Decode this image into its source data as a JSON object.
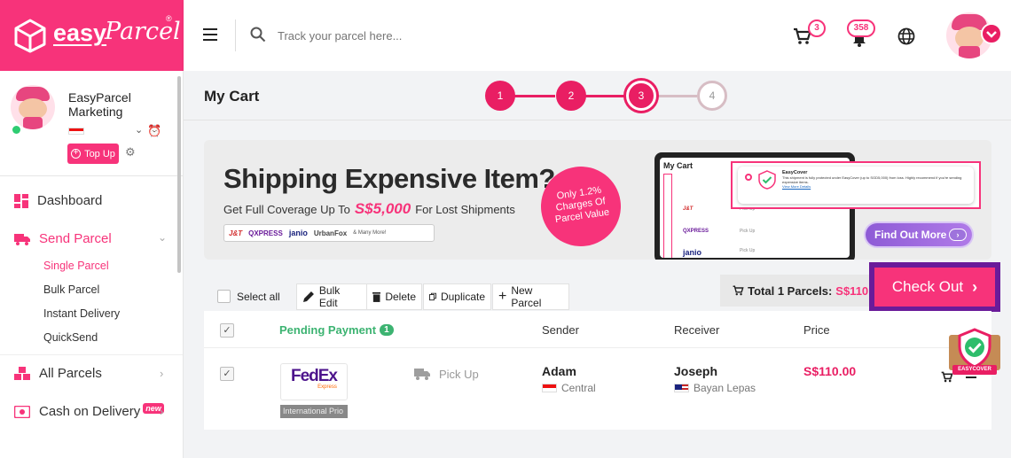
{
  "brand": {
    "name": "easy",
    "name_script": "Parcel",
    "registered": "®"
  },
  "search": {
    "placeholder": "Track your parcel here..."
  },
  "header": {
    "cart_count": "3",
    "notification_count": "358"
  },
  "profile": {
    "name": "EasyParcel Marketing",
    "topup_label": "Top Up"
  },
  "nav": {
    "dashboard": "Dashboard",
    "send_parcel": "Send Parcel",
    "sub_items": [
      "Single Parcel",
      "Bulk Parcel",
      "Instant Delivery",
      "QuickSend"
    ],
    "all_parcels": "All Parcels",
    "cod": "Cash on Delivery",
    "cod_badge": "new"
  },
  "page": {
    "title": "My Cart",
    "steps": [
      "1",
      "2",
      "3",
      "4"
    ],
    "current_step": 3
  },
  "banner": {
    "headline": "Shipping Expensive Item?",
    "subline_prefix": "Get Full Coverage Up To",
    "subline_amount": "S$5,000",
    "subline_suffix": "For Lost Shipments",
    "badge_line1": "Only 1.2%",
    "badge_line2": "Charges Of",
    "badge_line3": "Parcel Value",
    "couriers": [
      "J&T",
      "QXPRESS",
      "janio",
      "UrbanFox",
      "& Many More!"
    ],
    "mock_title": "My Cart",
    "mock_cover_title": "EasyCover",
    "mock_cover_text": "This shipment is fully protected under EasyCover (up to SGD5,000) from loss. Highly recommend if you're sending expensive items.",
    "mock_link": "View More Details",
    "mock_rows": [
      "Pick Up",
      "Pick Up",
      "Pick Up"
    ],
    "cta": "Find Out More"
  },
  "toolbar": {
    "select_all": "Select all",
    "bulk_edit": "Bulk Edit",
    "delete": "Delete",
    "duplicate": "Duplicate",
    "new_parcel": "New Parcel",
    "total_label": "Total 1 Parcels:",
    "total_value": "S$110.0",
    "checkout": "Check Out"
  },
  "table": {
    "group_label": "Pending Payment",
    "group_count": "1",
    "columns": [
      "Sender",
      "Receiver",
      "Price"
    ],
    "rows": [
      {
        "courier": "FedEx",
        "courier_sub": "Express",
        "service": "International Prio",
        "pickup": "Pick Up",
        "sender_name": "Adam",
        "sender_region": "Central",
        "receiver_name": "Joseph",
        "receiver_region": "Bayan Lepas",
        "price": "S$110.00"
      }
    ]
  },
  "easycover_badge": "EASYCOVER",
  "colors": {
    "brand": "#f7337a",
    "step_done": "#e91e63",
    "step_todo": "#c9a8b2",
    "checkout_border": "#6a1b9a",
    "price": "#e91e63",
    "pending": "#3cb371"
  }
}
